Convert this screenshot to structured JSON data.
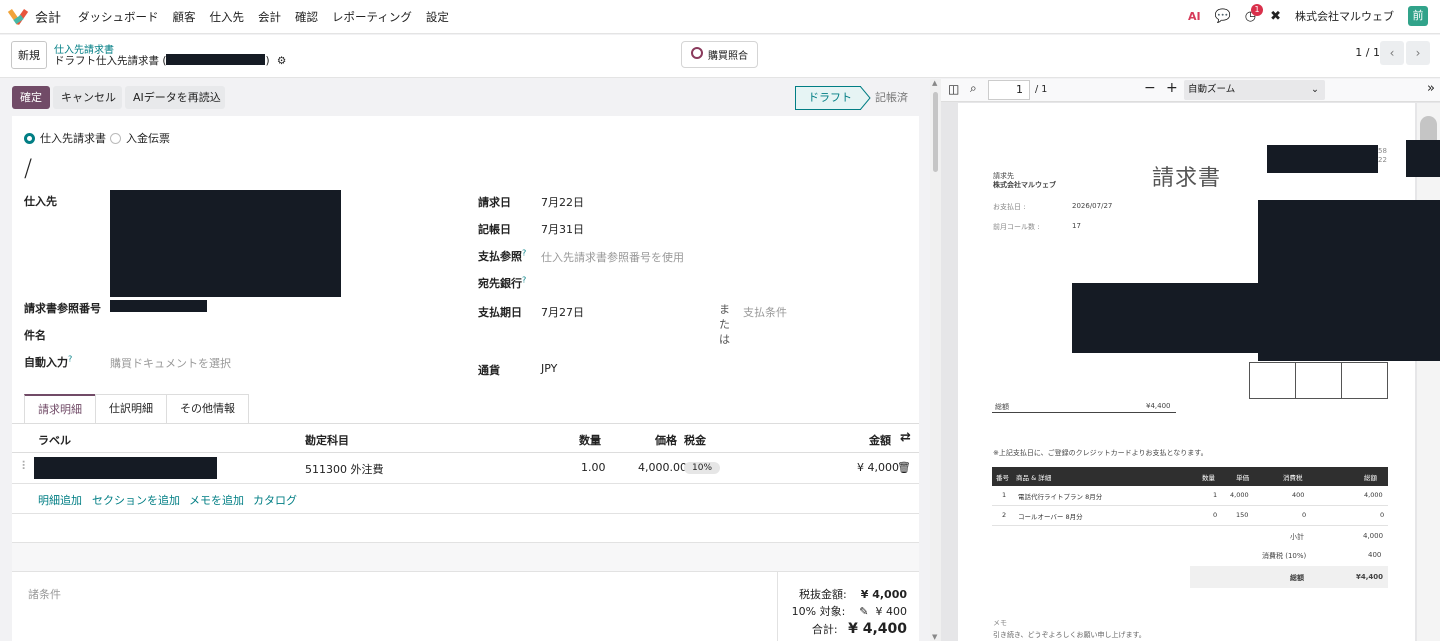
{
  "nav": {
    "app_name": "会計",
    "menu": [
      "ダッシュボード",
      "顧客",
      "仕入先",
      "会計",
      "確認",
      "レポーティング",
      "設定"
    ],
    "ai_label": "AI",
    "activity_badge": "1",
    "company": "株式会社マルウェブ",
    "avatar": "前"
  },
  "control": {
    "new_button": "新規",
    "breadcrumb_parent": "仕入先請求書",
    "breadcrumb_current": "ドラフト仕入先請求書 (",
    "breadcrumb_current_end": ")",
    "match_button": "購買照合",
    "pager": "1 / 1"
  },
  "actions": {
    "confirm": "確定",
    "cancel": "キャンセル",
    "reload_ai": "AIデータを再読込"
  },
  "status": {
    "draft": "ドラフト",
    "posted": "記帳済"
  },
  "form": {
    "move_type_bill": "仕入先請求書",
    "move_type_receipt": "入金伝票",
    "name": "/",
    "vendor_label": "仕入先",
    "ref_label": "請求書参照番号",
    "subject_label": "件名",
    "autofill_label": "自動入力",
    "autofill_placeholder": "購買ドキュメントを選択",
    "invoice_date_label": "請求日",
    "invoice_date": "7月22日",
    "accounting_date_label": "記帳日",
    "accounting_date": "7月31日",
    "payment_ref_label": "支払参照",
    "payment_ref_placeholder": "仕入先請求書参照番号を使用",
    "bank_label": "宛先銀行",
    "due_date_label": "支払期日",
    "due_date": "7月27日",
    "or_label": "または",
    "payment_terms_placeholder": "支払条件",
    "currency_label": "通貨",
    "currency": "JPY"
  },
  "tabs": [
    "請求明細",
    "仕訳明細",
    "その他情報"
  ],
  "lines": {
    "headers": {
      "label": "ラベル",
      "account": "勘定科目",
      "qty": "数量",
      "price": "価格",
      "tax": "税金",
      "amount": "金額"
    },
    "rows": [
      {
        "account": "511300 外注費",
        "qty": "1.00",
        "price": "4,000.00",
        "tax": "10%",
        "amount": "¥ 4,000"
      }
    ],
    "add_links": [
      "明細追加",
      "セクションを追加",
      "メモを追加",
      "カタログ"
    ]
  },
  "footer": {
    "terms_placeholder": "諸条件",
    "untaxed_label": "税抜金額:",
    "untaxed": "¥ 4,000",
    "tax_label": "10% 対象:",
    "tax": "¥ 400",
    "total_label": "合計:",
    "total": "¥ 4,400"
  },
  "pdf": {
    "page_input": "1",
    "page_total": "/ 1",
    "zoom": "自動ズーム",
    "title": "請求書",
    "to_label": "請求先",
    "to_company": "株式会社マルウェブ",
    "pay_date_label": "お支払日 :",
    "pay_date": "2026/07/27",
    "calls_label": "前月コール数 :",
    "calls": "17",
    "total_label": "総額",
    "total": "¥4,400",
    "note": "※上記支払日に、ご登録のクレジットカードよりお支払となります。",
    "table_headers": [
      "番号",
      "商品 & 詳細",
      "数量",
      "単価",
      "消費税",
      "総額"
    ],
    "table_rows": [
      [
        "1",
        "電話代行ライトプラン 8月分",
        "1",
        "4,000",
        "400",
        "4,000"
      ],
      [
        "2",
        "コールオーバー 8月分",
        "0",
        "150",
        "0",
        "0"
      ]
    ],
    "subtotal_label": "小計",
    "subtotal": "4,000",
    "consumption_label": "消費税 (10%)",
    "consumption": "400",
    "grand_label": "総額",
    "grand": "¥4,400",
    "memo_label": "メモ",
    "memo": "引き続き、どうぞよろしくお願い申し上げます。",
    "corner_top": "58",
    "corner_bottom": "22"
  }
}
